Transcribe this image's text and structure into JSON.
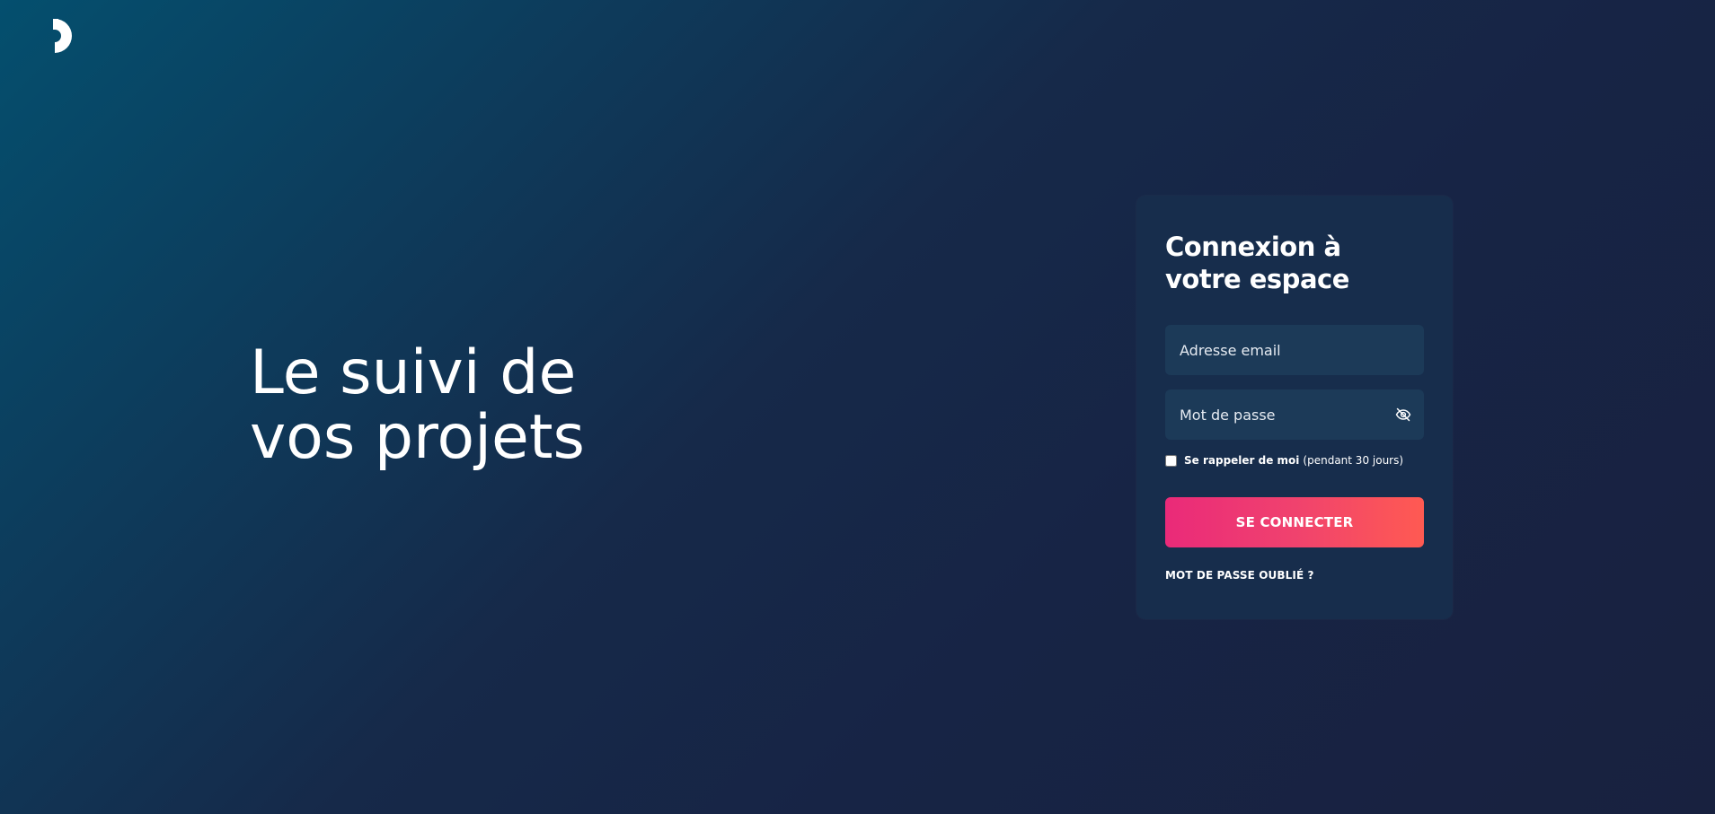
{
  "brand": {
    "logo_icon": "half-circle-logo-icon"
  },
  "hero": {
    "line1": "Le suivi de",
    "line2": "vos projets"
  },
  "login": {
    "title_line1": "Connexion à",
    "title_line2": "votre espace",
    "email_placeholder": "Adresse email",
    "email_value": "",
    "password_placeholder": "Mot de passe",
    "password_value": "",
    "password_toggle_icon": "eye-slash-icon",
    "remember_label": "Se rappeler de moi",
    "remember_note": "(pendant 30 jours)",
    "remember_checked": false,
    "submit_label": "SE CONNECTER",
    "forgot_label": "MOT DE PASSE OUBLIÉ ?"
  },
  "colors": {
    "background_top_left": "#044f6e",
    "background_bottom_right": "#18213f",
    "card": "#172d4c",
    "field": "#1c3a58",
    "button_start": "#ea2a79",
    "button_end": "#ff5a52"
  }
}
